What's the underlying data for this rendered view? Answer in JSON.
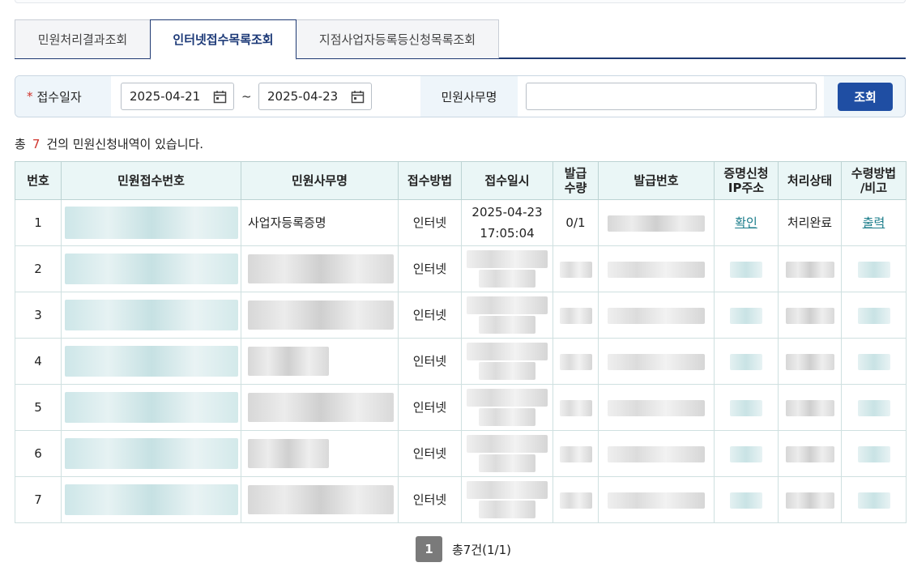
{
  "tabs": [
    {
      "label": "민원처리결과조회",
      "active": false
    },
    {
      "label": "인터넷접수목록조회",
      "active": true
    },
    {
      "label": "지점사업자등록등신청목록조회",
      "active": false
    }
  ],
  "search": {
    "date_label": "접수일자",
    "required_mark": "*",
    "date_from": "2025-04-21",
    "date_to": "2025-04-23",
    "tilde": "~",
    "name_label": "민원사무명",
    "name_value": "",
    "button_label": "조회"
  },
  "summary": {
    "prefix": "총",
    "count": "7",
    "suffix": "건의 민원신청내역이 있습니다."
  },
  "table": {
    "headers": [
      "번호",
      "민원접수번호",
      "민원사무명",
      "접수방법",
      "접수일시",
      "발급\n수량",
      "발급번호",
      "증명신청\nIP주소",
      "처리상태",
      "수령방법\n/비고"
    ],
    "rows": [
      {
        "no": "1",
        "name": "사업자등록증명",
        "method": "인터넷",
        "date": "2025-04-23",
        "time": "17:05:04",
        "qty": "0/1",
        "ip": "확인",
        "status": "처리완료",
        "note": "출력"
      },
      {
        "no": "2",
        "method": "인터넷"
      },
      {
        "no": "3",
        "method": "인터넷"
      },
      {
        "no": "4",
        "method": "인터넷"
      },
      {
        "no": "5",
        "method": "인터넷"
      },
      {
        "no": "6",
        "method": "인터넷"
      },
      {
        "no": "7",
        "method": "인터넷"
      }
    ]
  },
  "pager": {
    "current": "1",
    "info": "총7건(1/1)"
  },
  "colors": {
    "accent": "#1f4ea3",
    "tab_active": "#1d3a78",
    "header_bg": "#eaf6f6",
    "count_red": "#d0342c",
    "link": "#1a7c8a"
  }
}
